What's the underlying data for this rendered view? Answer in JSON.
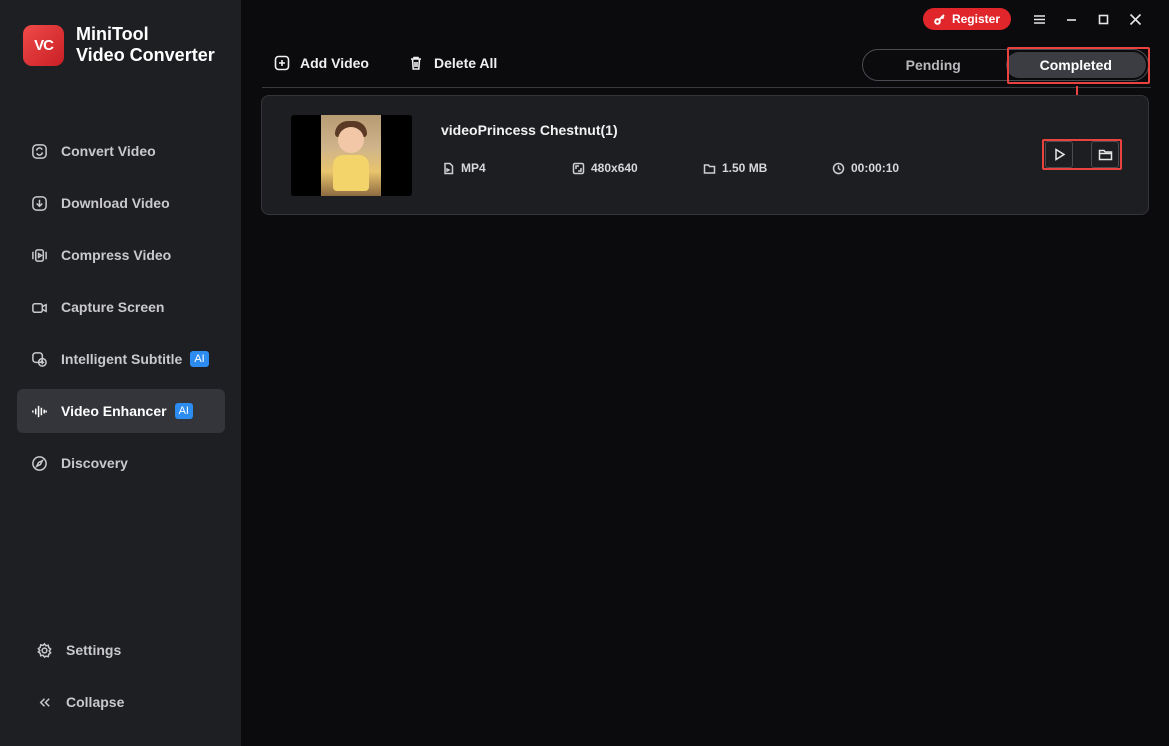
{
  "app": {
    "logo_text": "VC",
    "name_line1": "MiniTool",
    "name_line2": "Video Converter"
  },
  "titlebar": {
    "register_label": "Register"
  },
  "sidebar": {
    "items": [
      {
        "label": "Convert Video",
        "icon": "convert-icon"
      },
      {
        "label": "Download Video",
        "icon": "download-icon"
      },
      {
        "label": "Compress Video",
        "icon": "compress-icon"
      },
      {
        "label": "Capture Screen",
        "icon": "camera-icon"
      },
      {
        "label": "Intelligent Subtitle",
        "badge": "AI",
        "icon": "subtitle-icon"
      },
      {
        "label": "Video Enhancer",
        "badge": "AI",
        "icon": "waveform-icon",
        "active": true
      },
      {
        "label": "Discovery",
        "icon": "compass-icon"
      }
    ],
    "settings_label": "Settings",
    "collapse_label": "Collapse"
  },
  "toolbar": {
    "add_video_label": "Add Video",
    "delete_all_label": "Delete All"
  },
  "tabs": {
    "pending_label": "Pending",
    "completed_label": "Completed",
    "selected": "Completed"
  },
  "file": {
    "title": "videoPrincess Chestnut(1)",
    "format": "MP4",
    "resolution": "480x640",
    "size": "1.50 MB",
    "duration": "00:00:10"
  },
  "colors": {
    "accent_red": "#e0262b",
    "ai_badge_blue": "#2d8cf0",
    "highlight_red": "#e8433f"
  }
}
